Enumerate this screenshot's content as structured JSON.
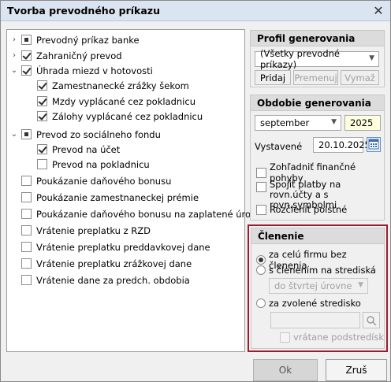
{
  "window": {
    "title": "Tvorba prevodného príkazu"
  },
  "tree": {
    "items": [
      {
        "label": "Prevodný príkaz banke",
        "state": "partial",
        "expander": "›"
      },
      {
        "label": "Zahraničný prevod",
        "state": "checked",
        "expander": "›"
      },
      {
        "label": "Úhrada miezd v hotovosti",
        "state": "checked",
        "expander": "⌄"
      },
      {
        "label": "Zamestnanecké zrážky šekom",
        "state": "checked"
      },
      {
        "label": "Mzdy vyplácané cez pokladnicu",
        "state": "checked"
      },
      {
        "label": "Zálohy vyplácané cez pokladnicu",
        "state": "checked"
      },
      {
        "label": "Prevod zo sociálneho fondu",
        "state": "partial",
        "expander": "⌄"
      },
      {
        "label": "Prevod na účet",
        "state": "checked"
      },
      {
        "label": "Prevod na pokladnicu",
        "state": "unchecked"
      },
      {
        "label": "Poukázanie daňového bonusu",
        "state": "unchecked"
      },
      {
        "label": "Poukázanie zamestnaneckej prémie",
        "state": "unchecked"
      },
      {
        "label": "Poukázanie daňového bonusu na zaplatené úroky",
        "state": "unchecked"
      },
      {
        "label": "Vrátenie preplatku z RZD",
        "state": "unchecked"
      },
      {
        "label": "Vrátenie preplatku preddavkovej dane",
        "state": "unchecked"
      },
      {
        "label": "Vrátenie preplatku zrážkovej dane",
        "state": "unchecked"
      },
      {
        "label": "Vrátenie dane za predch. obdobia",
        "state": "unchecked"
      }
    ]
  },
  "profil": {
    "header": "Profil generovania",
    "selected": "(Všetky prevodné príkazy)",
    "btn_add": "Pridaj",
    "btn_rename": "Premenuj",
    "btn_delete": "Vymaž"
  },
  "obdobie": {
    "header": "Obdobie generovania",
    "month": "september",
    "year": "2025",
    "issued_label": "Vystavené",
    "issued_date": "20.10.2025",
    "opt1": "Zohľadniť finančné pohyby",
    "opt2": "Spojiť platby na rovn.účty a s rovn.symbolmi",
    "opt3": "Rozčleniť poistné"
  },
  "clenenie": {
    "header": "Členenie",
    "r1": "za celú firmu bez členenia",
    "r2": "s členením na strediská",
    "level": "do štvrtej úrovne",
    "r3": "za zvolené stredisko",
    "center_value": "",
    "sub_label": "vrátane podstredísk",
    "highlight": "#9b1b30"
  },
  "footer": {
    "ok": "Ok",
    "cancel": "Zruš"
  }
}
